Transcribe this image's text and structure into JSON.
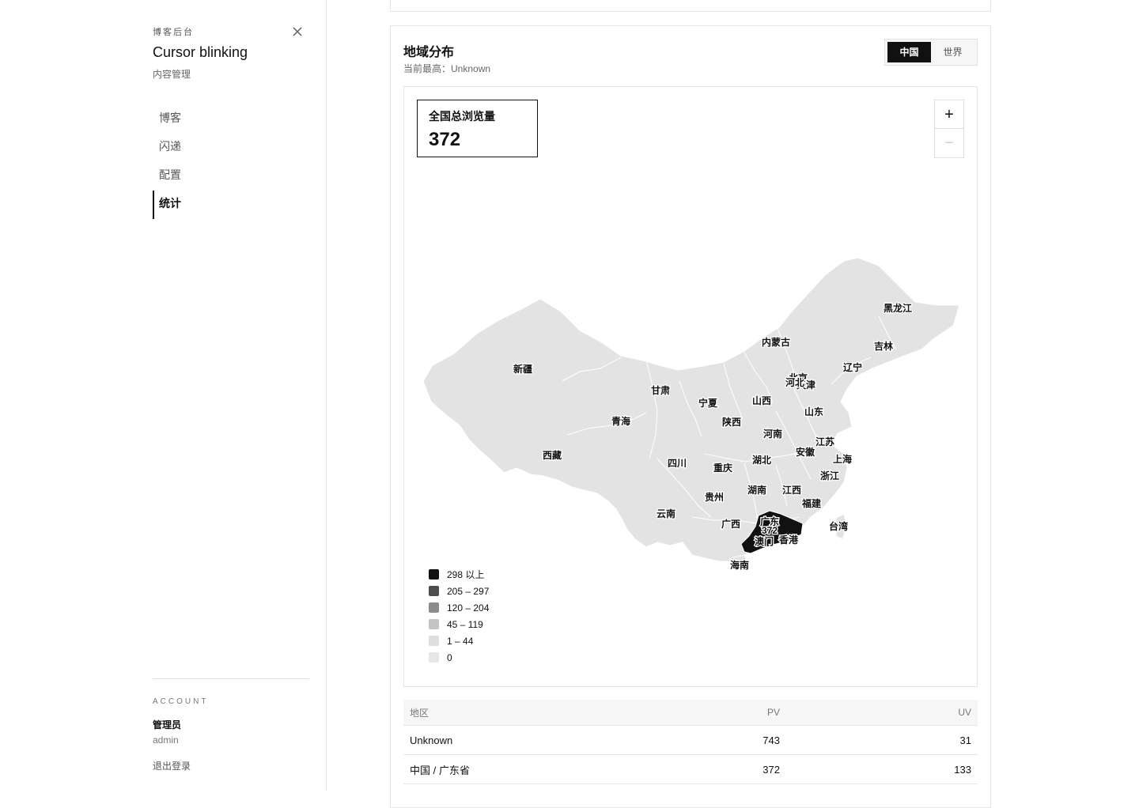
{
  "sidebar": {
    "kicker": "博客后台",
    "title": "Cursor blinking",
    "subtitle": "内容管理",
    "nav": [
      {
        "label": "博客",
        "active": false
      },
      {
        "label": "闪递",
        "active": false
      },
      {
        "label": "配置",
        "active": false
      },
      {
        "label": "统计",
        "active": true
      }
    ],
    "account": {
      "label": "ACCOUNT",
      "name": "管理员",
      "username": "admin",
      "logout": "退出登录"
    }
  },
  "region_card": {
    "title": "地域分布",
    "top_label": "当前最高：",
    "top_value": "Unknown",
    "tabs": [
      {
        "label": "中国",
        "active": true
      },
      {
        "label": "世界",
        "active": false
      }
    ],
    "total_label": "全国总浏览量",
    "total_value": "372",
    "zoom_in": "+",
    "zoom_out": "−"
  },
  "map": {
    "highlight_value": "372",
    "highlight_province": "广东",
    "colors": {
      "land": "#e3e3e3",
      "border": "#ffffff",
      "highlight": "#111111"
    },
    "provinces": [
      {
        "name": "黑龙江"
      },
      {
        "name": "吉林"
      },
      {
        "name": "辽宁"
      },
      {
        "name": "内蒙古"
      },
      {
        "name": "北京"
      },
      {
        "name": "天津"
      },
      {
        "name": "河北"
      },
      {
        "name": "山西"
      },
      {
        "name": "山东"
      },
      {
        "name": "新疆"
      },
      {
        "name": "甘肃"
      },
      {
        "name": "宁夏"
      },
      {
        "name": "陕西"
      },
      {
        "name": "河南"
      },
      {
        "name": "青海"
      },
      {
        "name": "江苏"
      },
      {
        "name": "安徽"
      },
      {
        "name": "上海"
      },
      {
        "name": "西藏"
      },
      {
        "name": "四川"
      },
      {
        "name": "湖北"
      },
      {
        "name": "重庆"
      },
      {
        "name": "浙江"
      },
      {
        "name": "湖南"
      },
      {
        "name": "江西"
      },
      {
        "name": "贵州"
      },
      {
        "name": "福建"
      },
      {
        "name": "云南"
      },
      {
        "name": "广西"
      },
      {
        "name": "广东"
      },
      {
        "name": "台湾"
      },
      {
        "name": "澳门"
      },
      {
        "name": "香港"
      },
      {
        "name": "海南"
      }
    ],
    "legend": [
      {
        "label": "298 以上",
        "color": "#111111"
      },
      {
        "label": "205 – 297",
        "color": "#4d4d4d"
      },
      {
        "label": "120 – 204",
        "color": "#8c8c8c"
      },
      {
        "label": "45 – 119",
        "color": "#c4c4c4"
      },
      {
        "label": "1 – 44",
        "color": "#dedede"
      },
      {
        "label": "0",
        "color": "#e6e6e6"
      }
    ]
  },
  "table": {
    "headers": {
      "region": "地区",
      "pv": "PV",
      "uv": "UV"
    },
    "rows": [
      {
        "region": "Unknown",
        "pv": "743",
        "uv": "31"
      },
      {
        "region": "中国 / 广东省",
        "pv": "372",
        "uv": "133"
      }
    ]
  }
}
